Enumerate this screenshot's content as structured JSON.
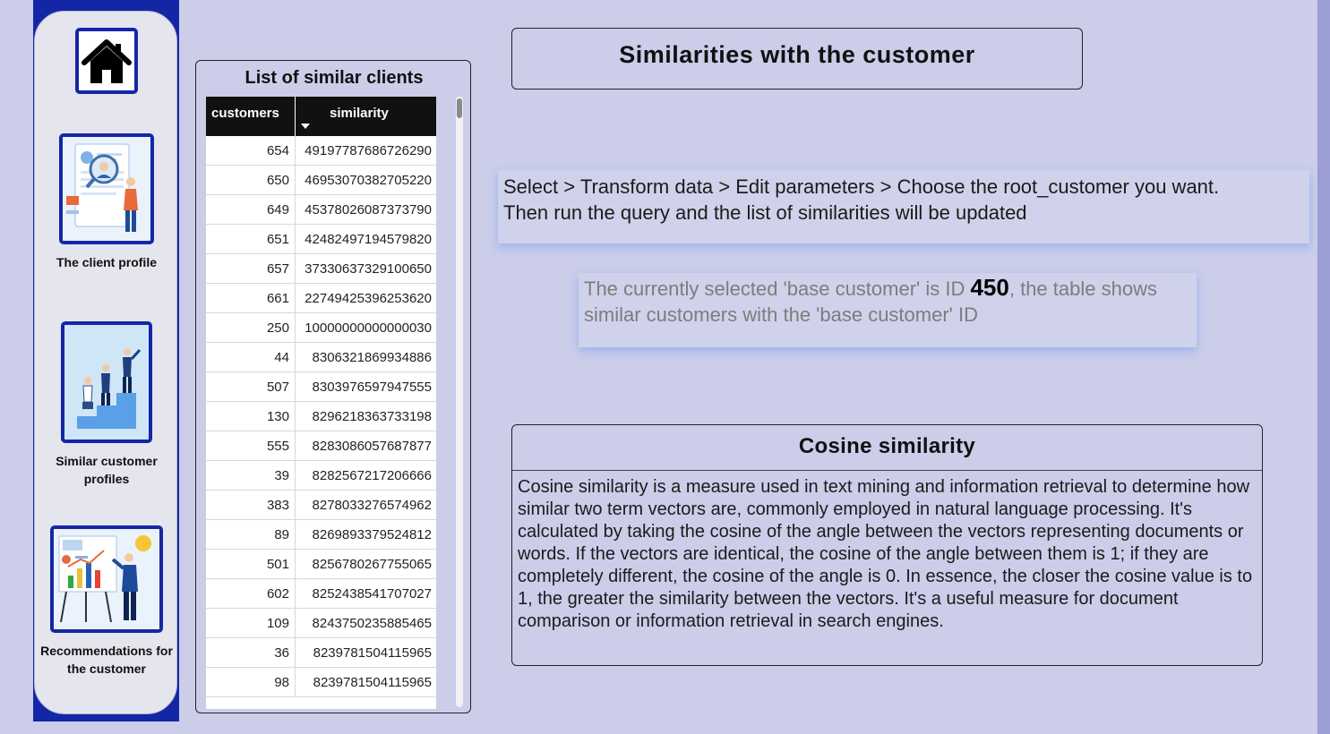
{
  "sidebar": {
    "items": [
      {
        "label": "",
        "icon": "home-icon"
      },
      {
        "label": "The client profile",
        "icon": "client-profile-illustration"
      },
      {
        "label": "Similar customer profiles",
        "icon": "similar-profiles-illustration"
      },
      {
        "label": "Recommendations for the customer",
        "icon": "recommendations-illustration"
      }
    ]
  },
  "table": {
    "title": "List of similar clients",
    "columns": [
      "customers",
      "similarity"
    ],
    "rows": [
      [
        "654",
        "49197787686726290"
      ],
      [
        "650",
        "46953070382705220"
      ],
      [
        "649",
        "45378026087373790"
      ],
      [
        "651",
        "42482497194579820"
      ],
      [
        "657",
        "37330637329100650"
      ],
      [
        "661",
        "22749425396253620"
      ],
      [
        "250",
        "10000000000000030"
      ],
      [
        "44",
        "8306321869934886"
      ],
      [
        "507",
        "8303976597947555"
      ],
      [
        "130",
        "8296218363733198"
      ],
      [
        "555",
        "8283086057687877"
      ],
      [
        "39",
        "8282567217206666"
      ],
      [
        "383",
        "8278033276574962"
      ],
      [
        "89",
        "8269893379524812"
      ],
      [
        "501",
        "8256780267755065"
      ],
      [
        "602",
        "8252438541707027"
      ],
      [
        "109",
        "8243750235885465"
      ],
      [
        "36",
        "8239781504115965"
      ],
      [
        "98",
        "8239781504115965"
      ]
    ]
  },
  "header": {
    "title": "Similarities with the customer"
  },
  "instructions": {
    "line1": "Select > Transform data > Edit parameters > Choose the root_customer you want.",
    "line2": "Then run the query and the list of similarities will be updated"
  },
  "selected": {
    "prefix": "The currently selected 'base customer' is ID ",
    "id": "450",
    "suffix": ", the table shows similar customers with the 'base customer' ID"
  },
  "cosine": {
    "title": "Cosine similarity",
    "text": "Cosine similarity is a measure used in text mining and information retrieval to determine how similar two term vectors are, commonly employed in natural language processing. It's calculated by taking the cosine of the angle between the vectors representing documents or words. If the vectors are identical, the cosine of the angle between them is 1; if they are completely different, the cosine of the angle is 0. In essence, the closer the cosine value is to 1, the greater the similarity between the vectors. It's a useful measure for document comparison or information retrieval in search engines."
  },
  "colors": {
    "accent": "#1327a6",
    "background": "#cbcde9",
    "glow": "#9bb1ec"
  }
}
